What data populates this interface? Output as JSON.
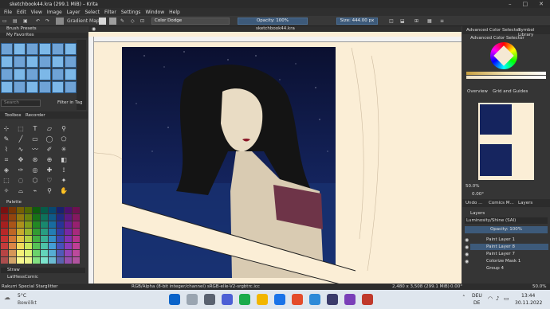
{
  "window": {
    "title": "sketchbook44.kra (299.1 MiB) – Krita"
  },
  "menu": [
    "File",
    "Edit",
    "View",
    "Image",
    "Layer",
    "Select",
    "Filter",
    "Settings",
    "Window",
    "Help"
  ],
  "toolbar": {
    "gradient_map": "Gradient Map",
    "blend_mode": "Color Dodge",
    "opacity": "Opacity: 100%",
    "size": "Size: 444.00 px"
  },
  "left": {
    "brush_presets": "Brush Presets",
    "my_favorites": "My Favorites",
    "search_placeholder": "Search",
    "filter_tag": "Filter in Tag",
    "toolbox": "Toolbox",
    "recorder": "Recorder",
    "palette": "Palette",
    "brush_name": "Rakurri Special Starglitter",
    "palette_name": "Straw",
    "palette_set": "LatHessComic"
  },
  "document": {
    "tab": "sketchbook44.kra"
  },
  "right": {
    "adv_color_selector_tab": "Advanced Color Selector",
    "symbol_library_tab": "Symbol Library",
    "adv_color_selector": "Advanced Color Selector",
    "overview": "Overview",
    "grid_guides": "Grid and Guides",
    "zoom": "50.0%",
    "rotation": "0.00°",
    "tabs": [
      "Undo ...",
      "Comics M...",
      "Layers"
    ],
    "layers_title": "Layers",
    "blend_mode": "Luminosity/Shine (SAI)",
    "opacity": "Opacity: 100%",
    "layers": [
      "Paint Layer 1",
      "Paint Layer 8",
      "Paint Layer 7",
      "Colorize Mask 1",
      "Group 4"
    ]
  },
  "status": {
    "color_model": "RGB/Alpha (8-bit integer/channel)  sRGB-elle-V2-srgbtrc.icc",
    "dimensions": "2,480 x 3,508 (299.1 MiB)",
    "rotation": "0.00°",
    "zoom": "50.0%"
  },
  "taskbar": {
    "temp": "5°C",
    "weather": "Bewölkt",
    "lang1": "DEU",
    "lang2": "DE",
    "time": "13:44",
    "date": "30.11.2022"
  }
}
